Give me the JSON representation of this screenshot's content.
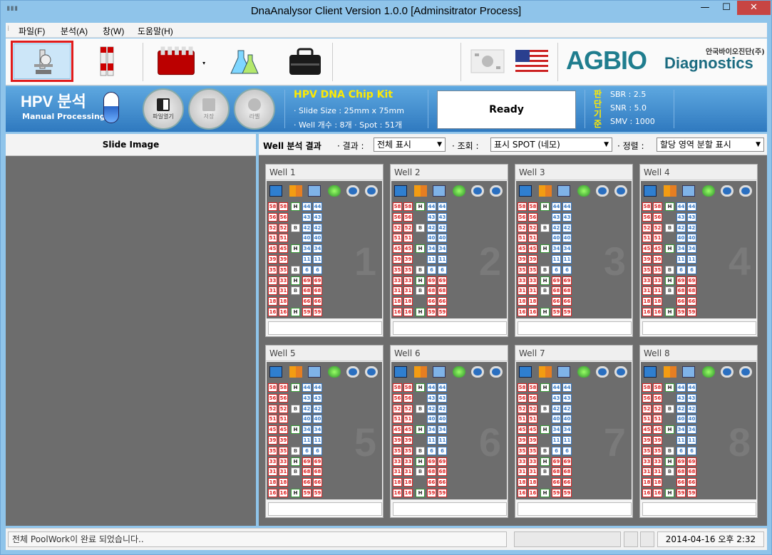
{
  "window": {
    "title": "DnaAnalysor Client Version 1.0.0 [Adminsitrator Process]",
    "icon": "app-icon",
    "min": "—",
    "max": "☐",
    "close": "✕"
  },
  "menu": [
    {
      "label": "파일(F)"
    },
    {
      "label": "분석(A)"
    },
    {
      "label": "창(W)"
    },
    {
      "label": "도움말(H)"
    }
  ],
  "toolbar": {
    "buttons": [
      "microscope-icon",
      "test-tubes-icon",
      "sample-rack-icon",
      "flasks-icon",
      "doctor-bag-icon"
    ],
    "languages": [
      "korean-flag-icon",
      "us-flag-icon"
    ],
    "logo_ag": "AGBIO",
    "logo_diag": "Diagnostics",
    "logo_kr": "안국바이오진단(주)"
  },
  "banner": {
    "title": "HPV 분석",
    "subtitle": "Manual Processing",
    "open_file": "파일열기",
    "save": "저장",
    "label": "라벨",
    "kit_title": "HPV DNA Chip Kit",
    "slide_size": "· Slide Size : 25mm x 75mm",
    "well_info": "· Well 개수 : 8개  · Spot : 51개",
    "status": "Ready",
    "criteria_label": "판단기준",
    "sbr": "SBR : 2.5",
    "snr": "SNR : 5.0",
    "smv": "SMV : 1000"
  },
  "left": {
    "header": "Slide Image"
  },
  "filters": {
    "title": "Well 분석 결과",
    "result_label": "· 결과 :",
    "result_value": "전체 표시",
    "query_label": "· 조회 :",
    "query_value": "표시 SPOT (네모)",
    "sort_label": "· 정렬 :",
    "sort_value": "할당 영역 분할 표시"
  },
  "wells": [
    {
      "title": "Well 1",
      "num": "1"
    },
    {
      "title": "Well 2",
      "num": "2"
    },
    {
      "title": "Well 3",
      "num": "3"
    },
    {
      "title": "Well 4",
      "num": "4"
    },
    {
      "title": "Well 5",
      "num": "5"
    },
    {
      "title": "Well 6",
      "num": "6"
    },
    {
      "title": "Well 7",
      "num": "7"
    },
    {
      "title": "Well 8",
      "num": "8"
    }
  ],
  "well_tools": [
    "monitor-icon",
    "grid-add-icon",
    "copy-icon",
    "globe-icon",
    "zoom-in-icon",
    "zoom-out-icon"
  ],
  "spot_rows": [
    [
      [
        "58",
        "r"
      ],
      [
        "58",
        "r"
      ],
      [
        "H",
        "g"
      ],
      [
        "44",
        "b"
      ],
      [
        "44",
        "b"
      ]
    ],
    [
      [
        "56",
        "r"
      ],
      [
        "56",
        "r"
      ],
      [
        "",
        ""
      ],
      [
        "43",
        "b"
      ],
      [
        "43",
        "b"
      ]
    ],
    [
      [
        "52",
        "r"
      ],
      [
        "52",
        "r"
      ],
      [
        "B",
        "k"
      ],
      [
        "42",
        "b"
      ],
      [
        "42",
        "b"
      ]
    ],
    [
      [
        "51",
        "r"
      ],
      [
        "51",
        "r"
      ],
      [
        "",
        ""
      ],
      [
        "40",
        "b"
      ],
      [
        "40",
        "b"
      ]
    ],
    [
      [
        "45",
        "r"
      ],
      [
        "45",
        "r"
      ],
      [
        "H",
        "g"
      ],
      [
        "34",
        "b"
      ],
      [
        "34",
        "b"
      ]
    ],
    [
      [
        "39",
        "r"
      ],
      [
        "39",
        "r"
      ],
      [
        "",
        ""
      ],
      [
        "11",
        "b"
      ],
      [
        "11",
        "b"
      ]
    ],
    [
      [
        "35",
        "r"
      ],
      [
        "35",
        "r"
      ],
      [
        "B",
        "k"
      ],
      [
        "6",
        "b"
      ],
      [
        "6",
        "b"
      ]
    ],
    [
      [
        "33",
        "r"
      ],
      [
        "33",
        "r"
      ],
      [
        "H",
        "g"
      ],
      [
        "69",
        "r"
      ],
      [
        "69",
        "r"
      ]
    ],
    [
      [
        "31",
        "r"
      ],
      [
        "31",
        "r"
      ],
      [
        "B",
        "k"
      ],
      [
        "68",
        "r"
      ],
      [
        "68",
        "r"
      ]
    ],
    [
      [
        "18",
        "r"
      ],
      [
        "18",
        "r"
      ],
      [
        "",
        ""
      ],
      [
        "66",
        "r"
      ],
      [
        "66",
        "r"
      ]
    ],
    [
      [
        "16",
        "r"
      ],
      [
        "16",
        "r"
      ],
      [
        "H",
        "g"
      ],
      [
        "59",
        "r"
      ],
      [
        "59",
        "r"
      ]
    ]
  ],
  "status": {
    "message": "전체 PoolWork이 완료 되었습니다..",
    "time": "2014-04-16 오후 2:32"
  }
}
